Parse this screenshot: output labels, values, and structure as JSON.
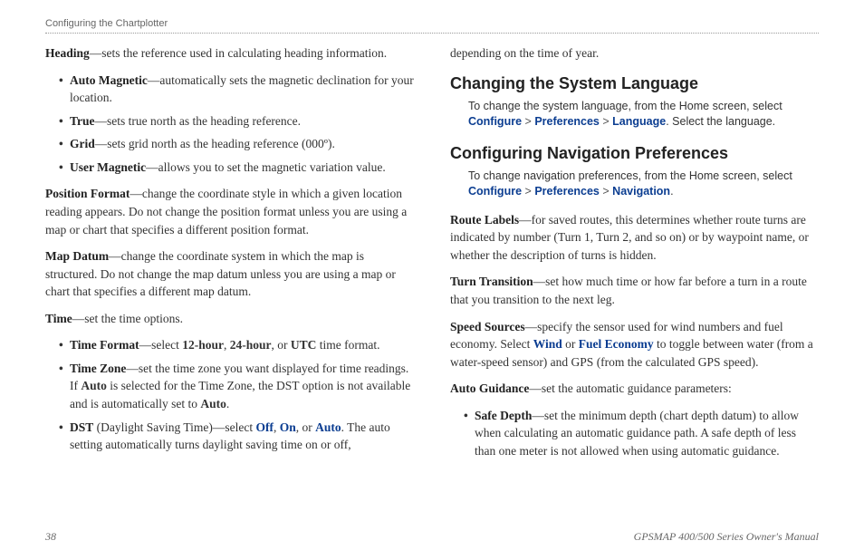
{
  "header": {
    "section": "Configuring the Chartplotter"
  },
  "left": {
    "heading_intro": {
      "term": "Heading",
      "rest": "—sets the reference used in calculating heading information."
    },
    "heading_list": [
      {
        "term": "Auto Magnetic",
        "rest": "—automatically sets the magnetic declination for your location."
      },
      {
        "term": "True",
        "rest": "—sets true north as the heading reference."
      },
      {
        "term": "Grid",
        "rest": "—sets grid north as the heading reference (000º)."
      },
      {
        "term": "User Magnetic",
        "rest": "—allows you to set the magnetic variation value."
      }
    ],
    "position_format": {
      "term": "Position Format",
      "rest": "—change the coordinate style in which a given location reading appears. Do not change the position format unless you are using a map or chart that specifies a different position format."
    },
    "map_datum": {
      "term": "Map Datum",
      "rest": "—change the coordinate system in which the map is structured. Do not change the map datum unless you are using a map or chart that specifies a different map datum."
    },
    "time_intro": {
      "term": "Time",
      "rest": "—set the time options."
    },
    "time_list": {
      "item0": {
        "term": "Time Format",
        "pre": "—select ",
        "b1": "12-hour",
        "c1": ", ",
        "b2": "24-hour",
        "c2": ", or ",
        "b3": "UTC",
        "post": " time format."
      },
      "item1": {
        "term": "Time Zone",
        "pre": "—set the time zone you want displayed for time readings. If ",
        "b1": "Auto",
        "mid": " is selected for the Time Zone, the DST option is not available and is automatically set to ",
        "b2": "Auto",
        "post": "."
      },
      "item2": {
        "term": "DST",
        "extra": " (Daylight Saving Time)—select ",
        "l1": "Off",
        "c1": ", ",
        "l2": "On",
        "c2": ", or ",
        "l3": "Auto",
        "post": ". The auto setting automatically turns daylight saving time on or off,"
      }
    }
  },
  "right": {
    "dst_cont": "depending on the time of year.",
    "lang_heading": "Changing the System Language",
    "lang_instr": {
      "pre": "To change the system language, from the Home screen, select ",
      "l1": "Configure",
      "l2": "Preferences",
      "l3": "Language",
      "post": ". Select the language."
    },
    "nav_heading": "Configuring Navigation Preferences",
    "nav_instr": {
      "pre": "To change navigation preferences, from the Home screen, select ",
      "l1": "Configure",
      "l2": "Preferences",
      "l3": "Navigation",
      "post": "."
    },
    "route_labels": {
      "term": "Route Labels",
      "rest": "—for saved routes, this determines whether route turns are indicated by number (Turn 1, Turn 2, and so on) or by waypoint name, or whether the description of turns is hidden."
    },
    "turn_transition": {
      "term": "Turn Transition",
      "rest": "—set how much time or how far before a turn in a route that you transition to the next leg."
    },
    "speed_sources": {
      "term": "Speed Sources",
      "pre": "—specify the sensor used for wind numbers and fuel economy. Select ",
      "l1": "Wind",
      "mid": " or ",
      "l2": "Fuel Economy",
      "post": " to toggle between water (from a water-speed sensor) and GPS (from the calculated GPS speed)."
    },
    "auto_guidance": {
      "term": "Auto Guidance",
      "rest": "—set the automatic guidance parameters:"
    },
    "ag_list": [
      {
        "term": "Safe Depth",
        "rest": "—set the minimum depth (chart depth datum) to allow when calculating an automatic guidance path. A safe depth of less than one meter is not allowed when using automatic guidance."
      }
    ]
  },
  "footer": {
    "page": "38",
    "manual": "GPSMAP 400/500 Series Owner's Manual"
  },
  "gt": ">"
}
